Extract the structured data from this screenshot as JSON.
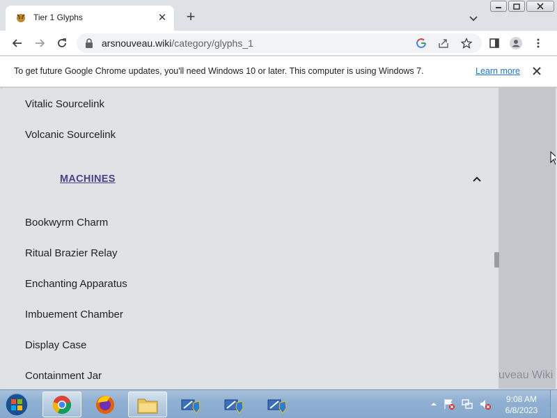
{
  "browser": {
    "tab": {
      "title": "Tier 1 Glyphs",
      "favicon": "ars-nouveau-favicon"
    },
    "new_tab_label": "+",
    "address": {
      "domain": "arsnouveau.wiki",
      "path": "/category/glyphs_1"
    },
    "icons": [
      "back-icon",
      "forward-icon",
      "reload-icon",
      "lock-icon",
      "google-icon",
      "share-icon",
      "star-icon",
      "side-panel-icon",
      "profile-icon",
      "menu-icon"
    ]
  },
  "infobar": {
    "message": "To get future Google Chrome updates, you'll need Windows 10 or later. This computer is using Windows 7.",
    "link": "Learn more"
  },
  "page": {
    "items_top": [
      "Vitalic Sourcelink",
      "Volcanic Sourcelink"
    ],
    "section": {
      "title": "MACHINES",
      "expanded": true
    },
    "items_machines": [
      "Bookwyrm Charm",
      "Ritual Brazier Relay",
      "Enchanting Apparatus",
      "Imbuement Chamber",
      "Display Case",
      "Containment Jar"
    ],
    "watermark": "uveau Wiki"
  },
  "taskbar": {
    "time": "9:08 AM",
    "date": "6/8/2023",
    "apps": [
      "chrome",
      "firefox",
      "file-explorer",
      "network-admin-1",
      "network-admin-2",
      "network-admin-3"
    ]
  },
  "colors": {
    "section_link": "#4b3f8a",
    "link": "#1a73e8",
    "panel": "#e1e2e6"
  }
}
